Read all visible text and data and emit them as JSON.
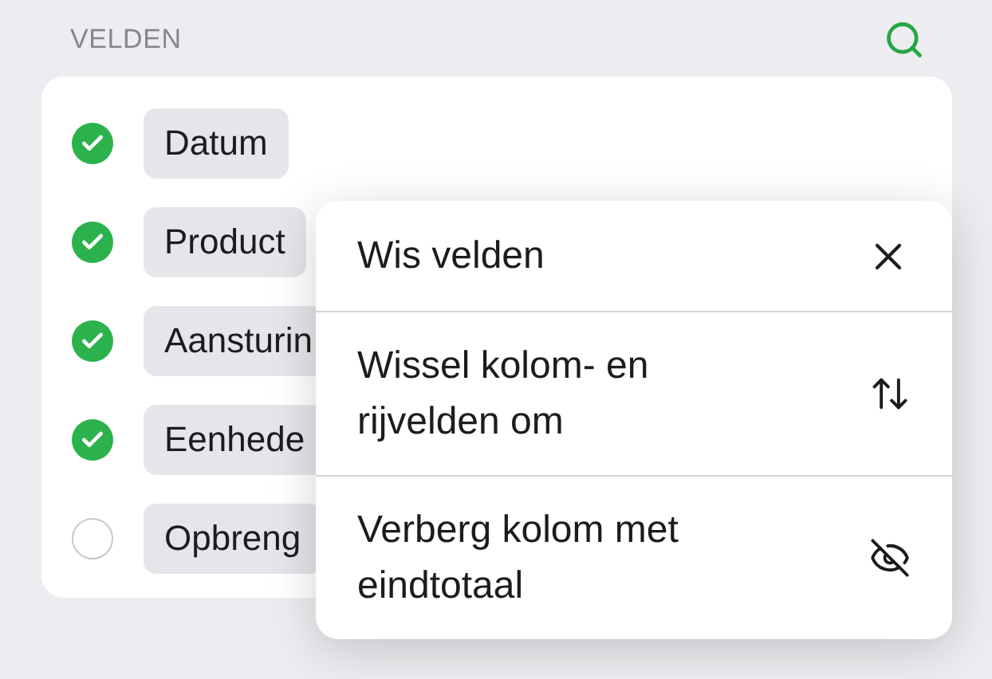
{
  "header": {
    "title": "VELDEN"
  },
  "fields": [
    {
      "label": "Datum",
      "checked": true
    },
    {
      "label": "Product",
      "checked": true
    },
    {
      "label": "Aansturin",
      "checked": true
    },
    {
      "label": "Eenhede",
      "checked": true
    },
    {
      "label": "Opbreng",
      "checked": false
    }
  ],
  "menu": [
    {
      "label": "Wis velden",
      "kind": "clear"
    },
    {
      "label": "Wissel kolom- en rijvelden om",
      "kind": "swap"
    },
    {
      "label": "Verberg kolom met eindtotaal",
      "kind": "hide"
    }
  ]
}
